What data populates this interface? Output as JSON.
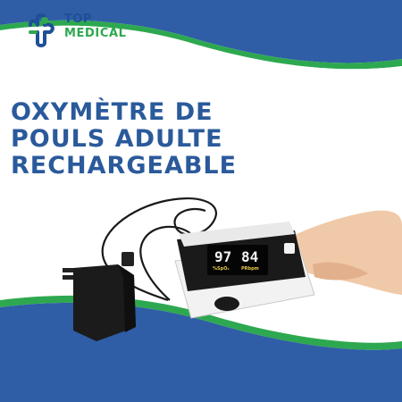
{
  "brand": {
    "name_top": "TOP",
    "name_bottom": "MEDICAL",
    "icon": "medical-cross-logo-icon",
    "logo_primary": "#1f4f96",
    "logo_accent": "#2fa84f"
  },
  "title": {
    "lines": [
      "OXYMÈTRE DE",
      "POULS ADULTE",
      "RECHARGEABLE"
    ],
    "color": "#2a5a9b"
  },
  "product": {
    "device": "pulse-oximeter-image",
    "charger": "wall-charger-image",
    "display": {
      "spo2": "97",
      "pulse": "84",
      "labels": [
        "%SpO₂",
        "PRbpm"
      ]
    }
  },
  "colors": {
    "band_blue": "#2f5da6",
    "band_green": "#2ea850",
    "background": "#ffffff"
  }
}
